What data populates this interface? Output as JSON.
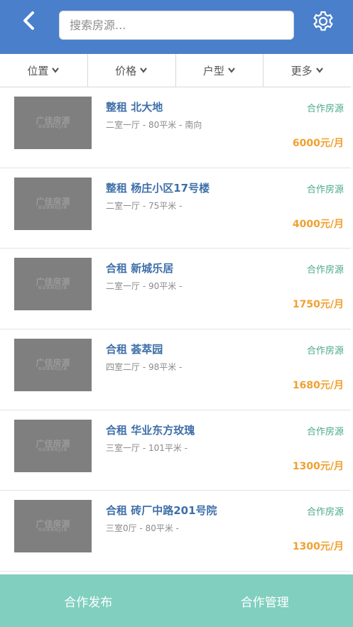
{
  "header": {
    "search_placeholder": "搜索房源..."
  },
  "filters": [
    {
      "label": "位置"
    },
    {
      "label": "价格"
    },
    {
      "label": "户型"
    },
    {
      "label": "更多"
    }
  ],
  "listings": [
    {
      "title": "整租 北大地",
      "detail": "二室一厅 - 80平米 - 南向",
      "tag": "合作房源",
      "price": "6000元/月"
    },
    {
      "title": "整租 杨庄小区17号楼",
      "detail": "二室一厅 - 75平米 -",
      "tag": "合作房源",
      "price": "4000元/月"
    },
    {
      "title": "合租 新城乐居",
      "detail": "二室一厅 - 90平米 -",
      "tag": "合作房源",
      "price": "1750元/月"
    },
    {
      "title": "合租 荟萃园",
      "detail": "四室二厅 - 98平米 -",
      "tag": "合作房源",
      "price": "1680元/月"
    },
    {
      "title": "合租 华业东方玫瑰",
      "detail": "三室一厅 - 101平米 -",
      "tag": "合作房源",
      "price": "1300元/月"
    },
    {
      "title": "合租 砖厂中路201号院",
      "detail": "三室0厅 - 80平米 -",
      "tag": "合作房源",
      "price": "1300元/月"
    }
  ],
  "thumb_logo": {
    "text": "广佳房源",
    "sub": "GUANGJIA"
  },
  "bottom": {
    "publish_label": "合作发布",
    "manage_label": "合作管理"
  },
  "colors": {
    "header": "#4a7fcb",
    "title": "#3e6fa8",
    "tag": "#4aa98a",
    "price": "#f0a030",
    "bottom_bar": "#80cfbf"
  }
}
